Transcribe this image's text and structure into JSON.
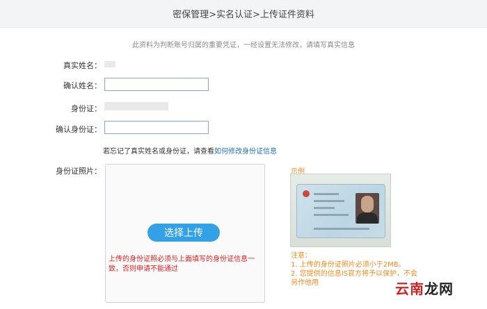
{
  "header": {
    "title": "密保管理>实名认证>上传证件资料"
  },
  "notice": "此资料为判断账号归属的重要凭证，一经设置无法修改，请填写真实信息",
  "form": {
    "real_name_label": "真实姓名：",
    "confirm_name_label": "确认姓名：",
    "id_label": "身份证：",
    "confirm_id_label": "确认身份证：",
    "confirm_name_value": "",
    "confirm_id_value": "",
    "photo_label": "身份证照片："
  },
  "hint": {
    "text": "若忘记了真实姓名或身份证，请查看",
    "link": "如何修改身份证信息"
  },
  "upload": {
    "button_label": "选择上传",
    "warning": "上传的身份证照必须与上面填写的身份证信息一致，否则申请不能通过"
  },
  "example": {
    "title": "示例",
    "notes_title": "注意：",
    "note1": "1. 上传的身份证照片必须小于2MB。",
    "note2": "2. 您提供的信息IS官方将予以保护，不会另作他用"
  },
  "watermark": {
    "red": "云南",
    "dark": "龙网"
  }
}
